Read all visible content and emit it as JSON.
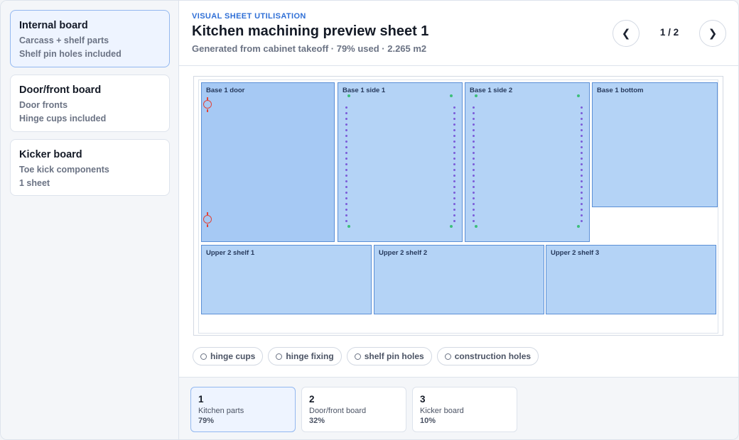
{
  "sidebar": {
    "boards": [
      {
        "title": "Internal board",
        "line1": "Carcass + shelf parts",
        "line2": "Shelf pin holes included"
      },
      {
        "title": "Door/front board",
        "line1": "Door fronts",
        "line2": "Hinge cups included"
      },
      {
        "title": "Kicker board",
        "line1": "Toe kick components",
        "line2": "1 sheet"
      }
    ]
  },
  "header": {
    "eyebrow": "VISUAL SHEET UTILISATION",
    "title": "Kitchen machining preview sheet 1",
    "subtitle": "Generated from cabinet takeoff · 79% used · 2.265 m2",
    "prev_icon": "❮",
    "next_icon": "❯",
    "page_indicator": "1 / 2"
  },
  "sheet": {
    "parts": [
      {
        "label": "Base 1 door"
      },
      {
        "label": "Base 1 side 1"
      },
      {
        "label": "Base 1 side 2"
      },
      {
        "label": "Base 1 bottom"
      },
      {
        "label": "Upper 2 shelf 1"
      },
      {
        "label": "Upper 2 shelf 2"
      },
      {
        "label": "Upper 2 shelf 3"
      }
    ]
  },
  "legend": [
    {
      "label": "hinge cups"
    },
    {
      "label": "hinge fixing"
    },
    {
      "label": "shelf pin holes"
    },
    {
      "label": "construction holes"
    }
  ],
  "sheets": [
    {
      "num": "1",
      "name": "Kitchen parts",
      "pct": "79%"
    },
    {
      "num": "2",
      "name": "Door/front board",
      "pct": "32%"
    },
    {
      "num": "3",
      "name": "Kicker board",
      "pct": "10%"
    }
  ],
  "colors": {
    "accent": "#2f6fd6",
    "part_fill": "#b4d3f6",
    "part_border": "#5b8fd6",
    "hinge_cup": "#e0443a",
    "shelf_pin": "#7b5bd8",
    "construction_hole": "#3cbf7a"
  }
}
